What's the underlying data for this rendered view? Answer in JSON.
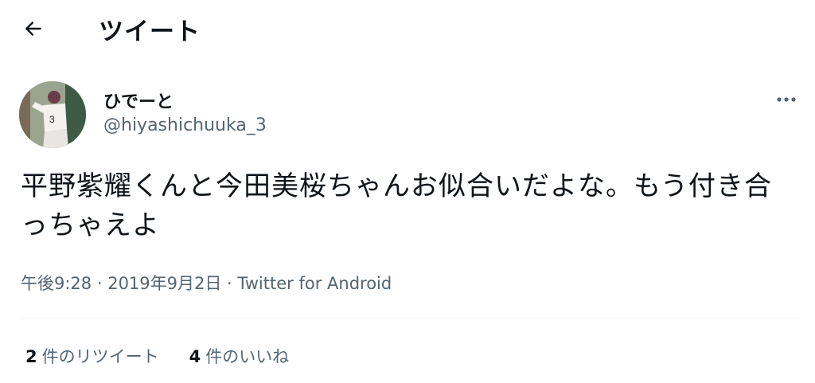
{
  "header": {
    "back_icon": "arrow-left-icon",
    "title": "ツイート"
  },
  "tweet": {
    "author_name": "ひでーと",
    "author_handle": "@hiyashichuuka_3",
    "more_icon": "more-horizontal-icon",
    "text": "平野紫耀くんと今田美桜ちゃんお似合いだよな。もう付き合っちゃえよ",
    "time": "午後9:28",
    "separator": " · ",
    "date": "2019年9月2日",
    "source": "Twitter for Android"
  },
  "stats": {
    "retweet_count": "2",
    "retweet_label": "件のリツイート",
    "like_count": "4",
    "like_label": "件のいいね"
  },
  "colors": {
    "text_primary": "#0f1419",
    "text_secondary": "#536471",
    "divider": "#eff3f4"
  }
}
